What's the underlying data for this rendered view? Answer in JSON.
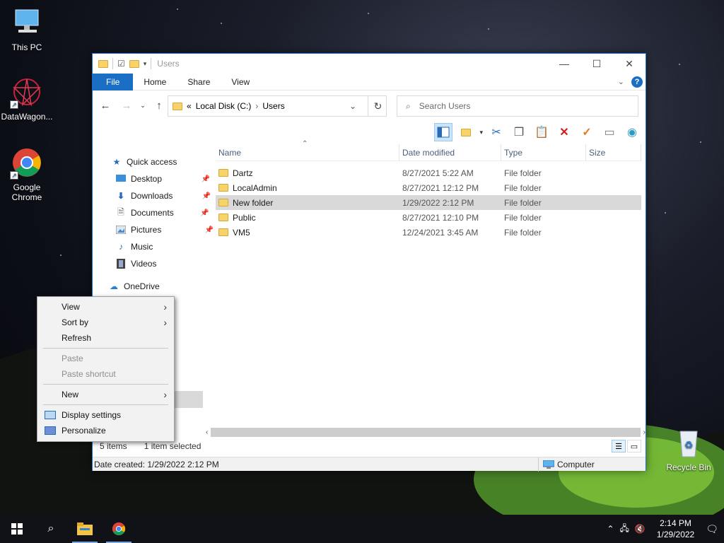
{
  "desktop": {
    "icons": [
      {
        "label": "This PC",
        "icon": "computer-icon"
      },
      {
        "label": "DataWagon...",
        "icon": "datawagon-icon"
      },
      {
        "label": "Google Chrome",
        "icon": "chrome-icon"
      },
      {
        "label": "Recycle Bin",
        "icon": "recycle-bin-icon"
      }
    ]
  },
  "window": {
    "title": "Users",
    "ribbon_tabs": [
      "File",
      "Home",
      "Share",
      "View"
    ],
    "address": {
      "prefix": "«",
      "crumbs": [
        "Local Disk (C:)",
        "Users"
      ]
    },
    "search_placeholder": "Search Users",
    "nav": {
      "quick_access": "Quick access",
      "items": [
        {
          "label": "Desktop",
          "pinned": true
        },
        {
          "label": "Downloads",
          "pinned": true
        },
        {
          "label": "Documents",
          "pinned": true
        },
        {
          "label": "Pictures",
          "pinned": true
        },
        {
          "label": "Music",
          "pinned": false
        },
        {
          "label": "Videos",
          "pinned": false
        }
      ],
      "onedrive": "OneDrive"
    },
    "columns": [
      "Name",
      "Date modified",
      "Type",
      "Size"
    ],
    "files": [
      {
        "name": "Dartz",
        "date": "8/27/2021 5:22 AM",
        "type": "File folder"
      },
      {
        "name": "LocalAdmin",
        "date": "8/27/2021 12:12 PM",
        "type": "File folder"
      },
      {
        "name": "New folder",
        "date": "1/29/2022 2:12 PM",
        "type": "File folder",
        "selected": true
      },
      {
        "name": "Public",
        "date": "8/27/2021 12:10 PM",
        "type": "File folder"
      },
      {
        "name": "VM5",
        "date": "12/24/2021 3:45 AM",
        "type": "File folder"
      }
    ],
    "status": {
      "count": "5 items",
      "selection": "1 item selected"
    },
    "details": {
      "created": "Date created: 1/29/2022 2:12 PM",
      "location": "Computer"
    }
  },
  "context_menu": {
    "view": "View",
    "sort_by": "Sort by",
    "refresh": "Refresh",
    "paste": "Paste",
    "paste_shortcut": "Paste shortcut",
    "new": "New",
    "display_settings": "Display settings",
    "personalize": "Personalize"
  },
  "taskbar": {
    "time": "2:14 PM",
    "date": "1/29/2022"
  },
  "colors": {
    "accent": "#1a6fc4",
    "folder": "#f6d36b",
    "selection": "#d9d9d9"
  }
}
